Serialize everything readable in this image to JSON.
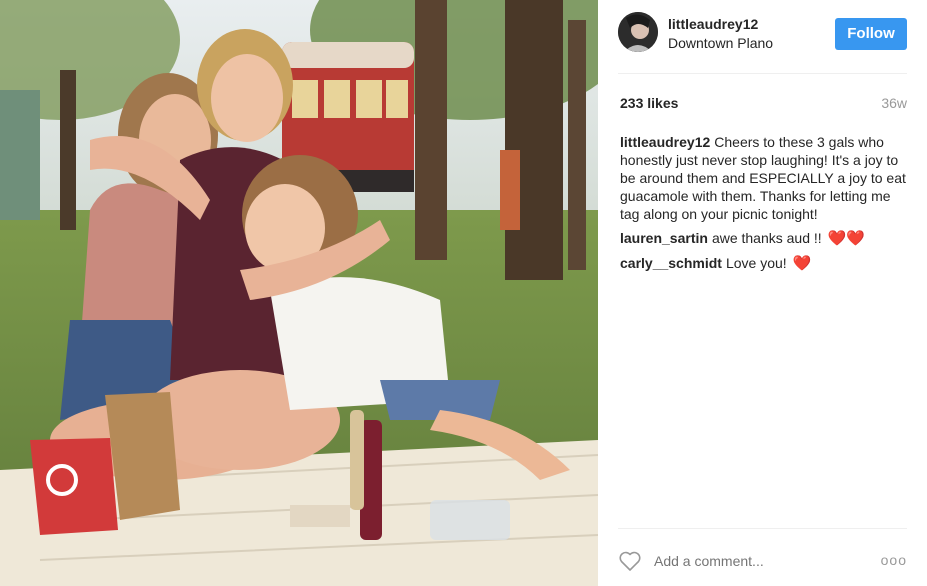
{
  "post": {
    "username": "littleaudrey12",
    "location": "Downtown Plano",
    "follow_label": "Follow",
    "likes": "233 likes",
    "age": "36w",
    "caption": {
      "user": "littleaudrey12",
      "text": "Cheers to these 3 gals who honestly just never stop laughing! It's a joy to be around them and ESPECIALLY a joy to eat guacamole with them. Thanks for letting me tag along on your picnic tonight!"
    },
    "comments": [
      {
        "user": "lauren_sartin",
        "text": "awe thanks aud !!",
        "emoji": "❤️❤️"
      },
      {
        "user": "carly__schmidt",
        "text": "Love you!",
        "emoji": "❤️"
      }
    ],
    "add_comment_placeholder": "Add a comment...",
    "more_label": "ooo"
  },
  "colors": {
    "accent": "#3897f0",
    "text": "#262626",
    "muted": "#999999"
  },
  "icons": {
    "like": "heart-outline-icon",
    "more": "more-options-icon"
  }
}
